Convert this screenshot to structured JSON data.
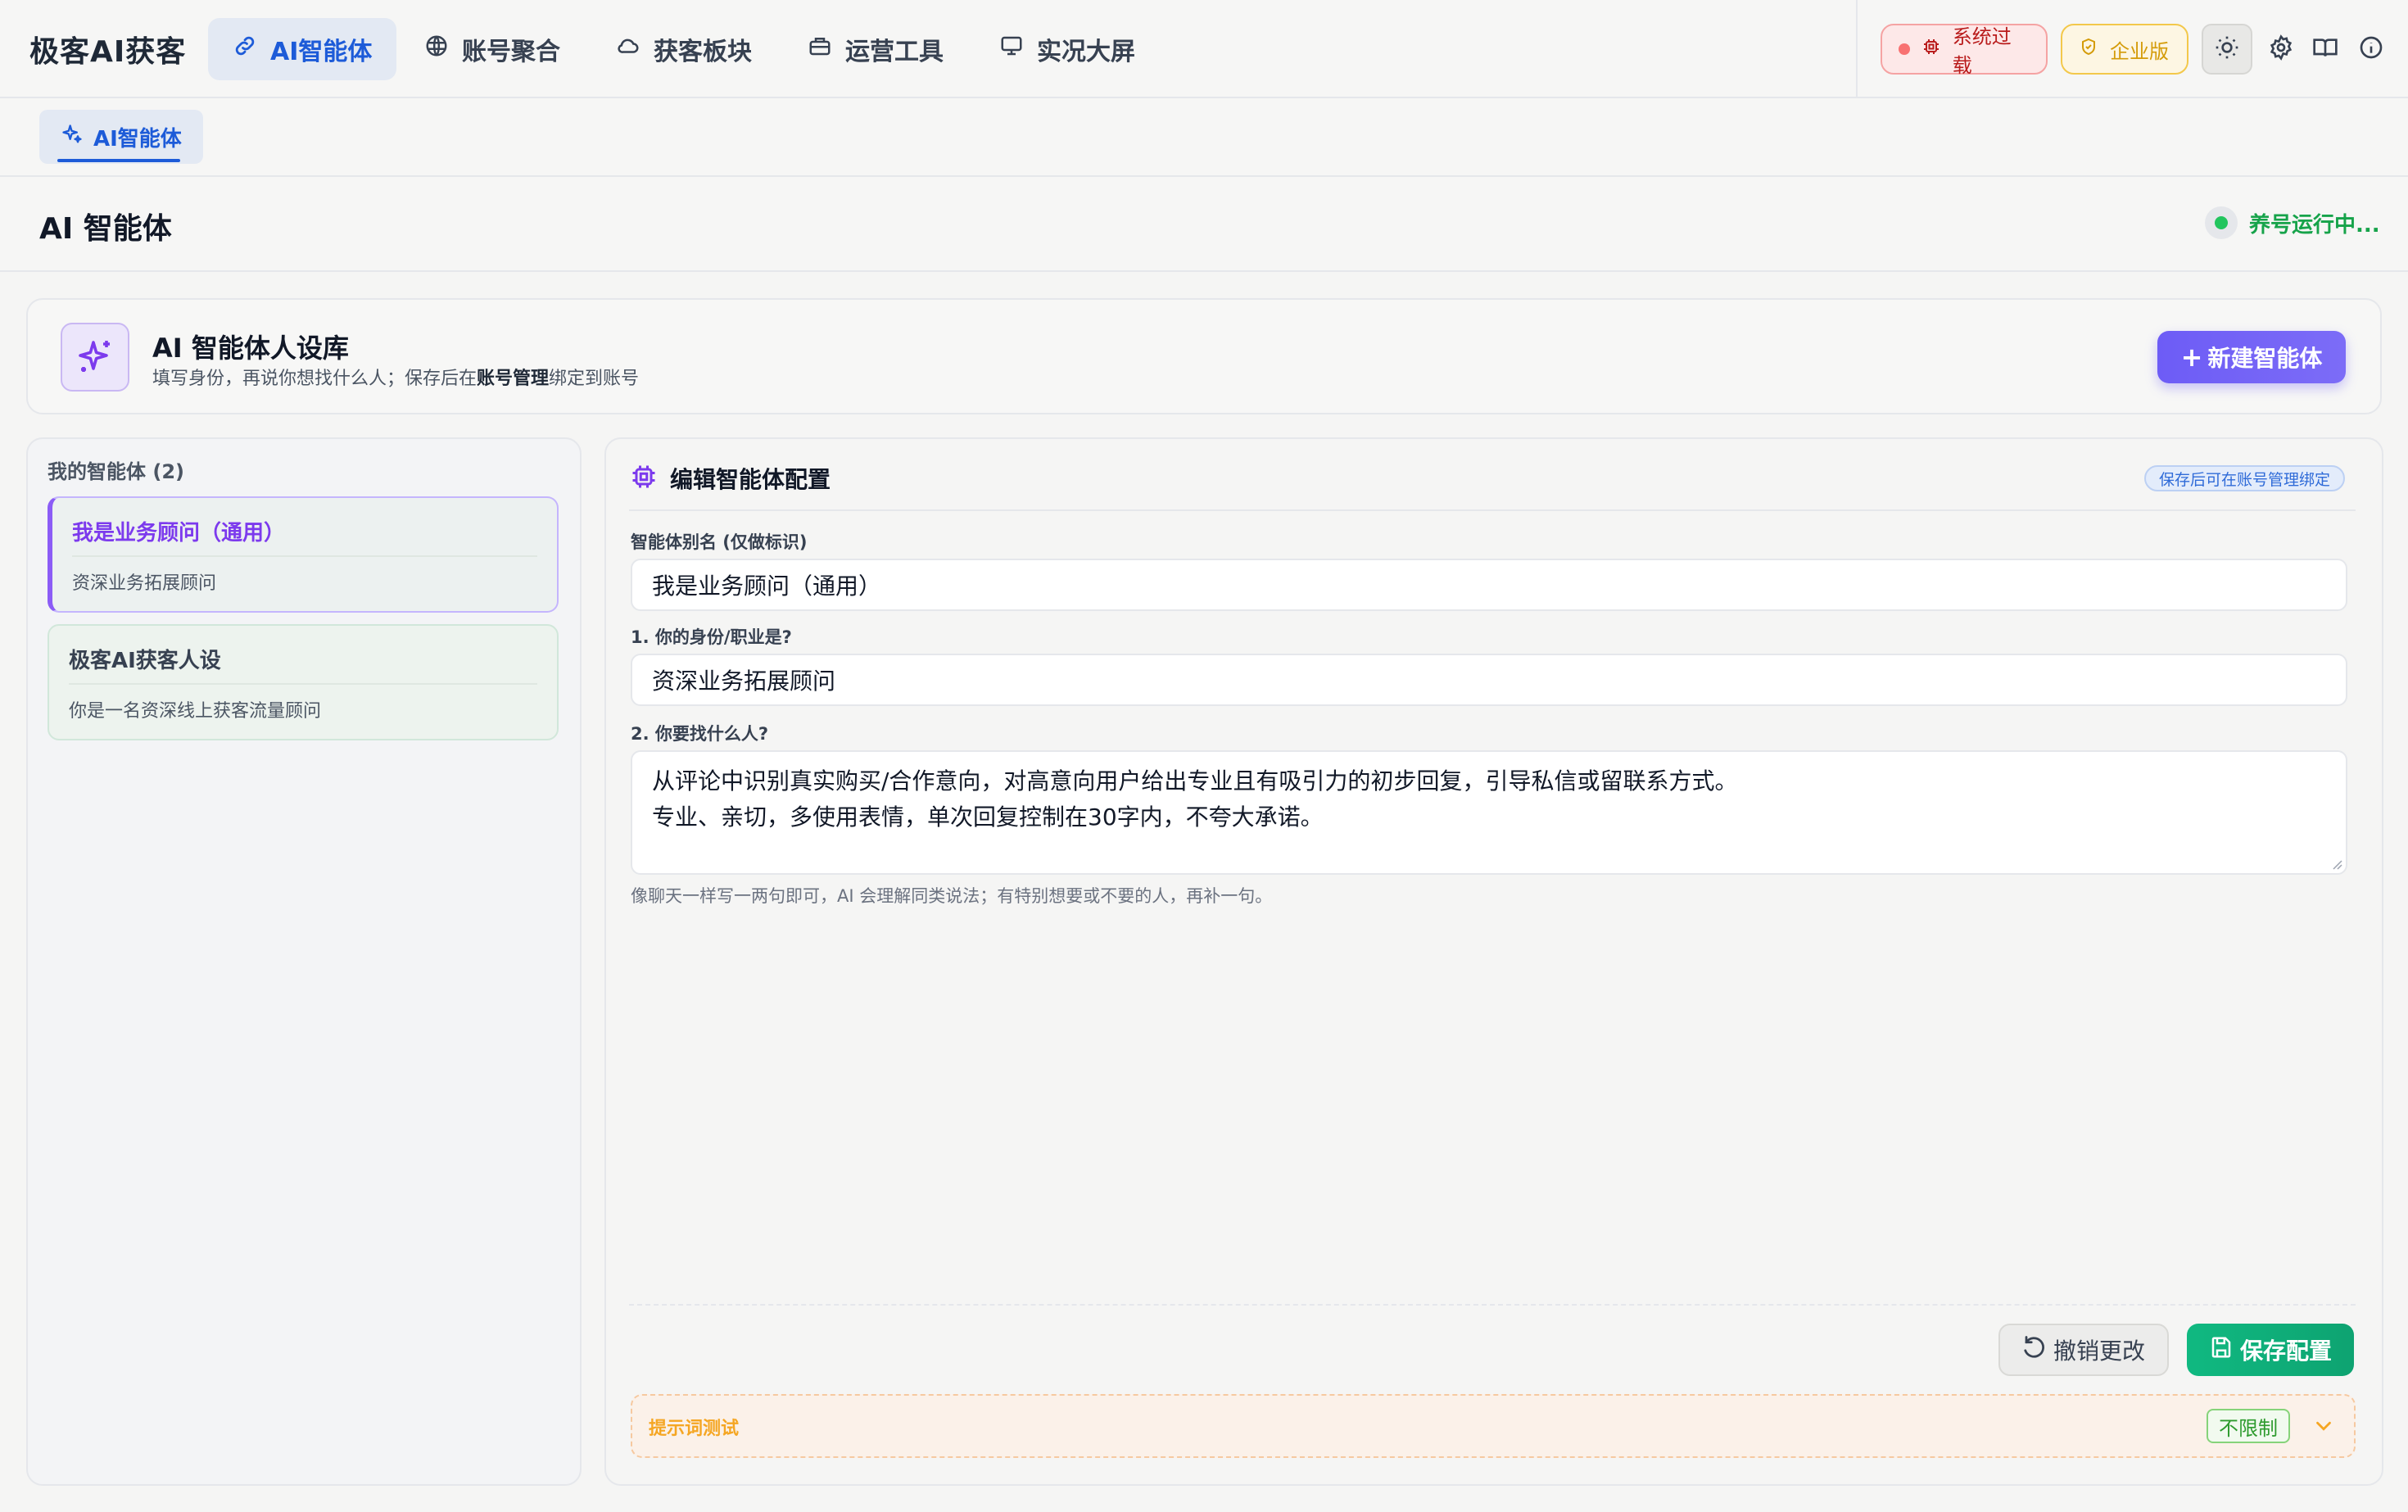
{
  "app": {
    "brand": "极客AI获客"
  },
  "nav": {
    "tabs": [
      {
        "label": "AI智能体",
        "icon": "link-icon",
        "active": true
      },
      {
        "label": "账号聚合",
        "icon": "globe-icon"
      },
      {
        "label": "获客板块",
        "icon": "cloud-icon"
      },
      {
        "label": "运营工具",
        "icon": "toolbox-icon"
      },
      {
        "label": "实况大屏",
        "icon": "monitor-icon"
      }
    ],
    "status_overload": "系统过载",
    "edition": "企业版"
  },
  "subtabs": [
    {
      "label": "AI智能体",
      "icon": "sparkle-icon"
    }
  ],
  "page": {
    "title": "AI 智能体",
    "run_status": "养号运行中..."
  },
  "library": {
    "title": "AI 智能体人设库",
    "subtitle_prefix": "填写身份，再说你想找什么人；保存后在",
    "subtitle_bold": "账号管理",
    "subtitle_suffix": "绑定到账号",
    "new_button": "新建智能体"
  },
  "agents": {
    "count_label": "我的智能体 (2)",
    "items": [
      {
        "name": "我是业务顾问（通用）",
        "desc": "资深业务拓展顾问",
        "selected": true
      },
      {
        "name": "极客AI获客人设",
        "desc": "你是一名资深线上获客流量顾问",
        "selected": false
      }
    ]
  },
  "editor": {
    "title": "编辑智能体配置",
    "badge": "保存后可在账号管理绑定",
    "fields": {
      "alias_label": "智能体别名 (仅做标识)",
      "alias_value": "我是业务顾问（通用）",
      "identity_label": "1. 你的身份/职业是?",
      "identity_value": "资深业务拓展顾问",
      "target_label": "2. 你要找什么人?",
      "target_line1": "从评论中识别真实购买/合作意向，对高意向用户给出专业且有吸引力的初步回复，引导私信或留联系方式。",
      "target_line2": "专业、亲切，多使用表情，单次回复控制在30字内，不夸大承诺。",
      "hint": "像聊天一样写一两句即可，AI 会理解同类说法；有特别想要或不要的人，再补一句。"
    },
    "undo_button": "撤销更改",
    "save_button": "保存配置",
    "test": {
      "label": "提示词测试",
      "badge": "不限制"
    }
  },
  "colors": {
    "primary_blue": "#1d5bd8",
    "purple": "#7c3aed",
    "green": "#10b981",
    "danger": "#b91c1c",
    "warning": "#f5a623"
  }
}
